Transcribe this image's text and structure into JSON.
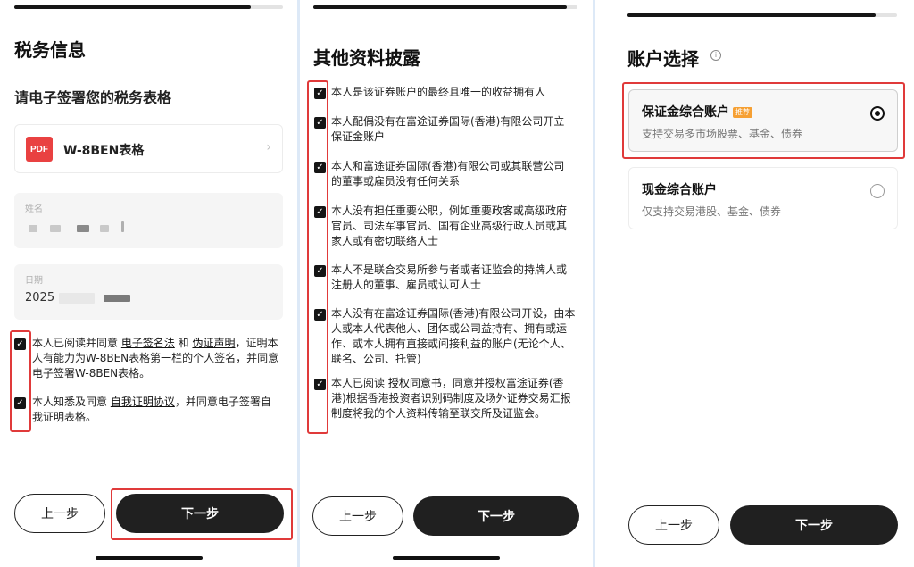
{
  "panel1": {
    "title": "税务信息",
    "subtitle": "请电子签署您的税务表格",
    "pdf_badge": "PDF",
    "pdf_label": "W-8BEN表格",
    "name_label": "姓名",
    "date_label": "日期",
    "date_value": "2025",
    "checks": [
      {
        "pre": "本人已阅读并同意 ",
        "link1": "电子签名法",
        "mid": " 和 ",
        "link2": "伪证声明",
        "post": "，证明本人有能力为W-8BEN表格第一栏的个人签名，并同意电子签署W-8BEN表格。"
      },
      {
        "pre": "本人知悉及同意 ",
        "link1": "自我证明协议",
        "post": "，并同意电子签署自我证明表格。"
      }
    ],
    "back_label": "上一步",
    "next_label": "下一步"
  },
  "panel2": {
    "title": "其他资料披露",
    "items": [
      "本人是该证券账户的最终且唯一的收益拥有人",
      "本人配偶没有在富途证券国际(香港)有限公司开立保证金账户",
      "本人和富途证券国际(香港)有限公司或其联营公司的董事或雇员没有任何关系",
      "本人没有担任重要公职，例如重要政客或高级政府官员、司法军事官员、国有企业高级行政人员或其家人或有密切联络人士",
      "本人不是联合交易所参与者或者证监会的持牌人或注册人的董事、雇员或认可人士",
      "本人没有在富途证券国际(香港)有限公司开设，由本人或本人代表他人、团体或公司益持有、拥有或运作、或本人拥有直接或间接利益的账户(无论个人、联名、公司、托管)"
    ],
    "last_item": {
      "pre": "本人已阅读 ",
      "link": "授权同意书",
      "post": "，同意并授权富途证券(香港)根据香港投资者识别码制度及场外证券交易汇报制度将我的个人资料传输至联交所及证监会。"
    },
    "back_label": "上一步",
    "next_label": "下一步"
  },
  "panel3": {
    "title": "账户选择",
    "accounts": [
      {
        "name": "保证金综合账户",
        "tag": "推荐",
        "desc": "支持交易多市场股票、基金、债券"
      },
      {
        "name": "现金综合账户",
        "desc": "仅支持交易港股、基金、债券"
      }
    ],
    "back_label": "上一步",
    "next_label": "下一步"
  },
  "colors": {
    "highlight": "#e03a3a",
    "primary": "#202020",
    "tag": "#f6a033",
    "pdf": "#e94141"
  }
}
